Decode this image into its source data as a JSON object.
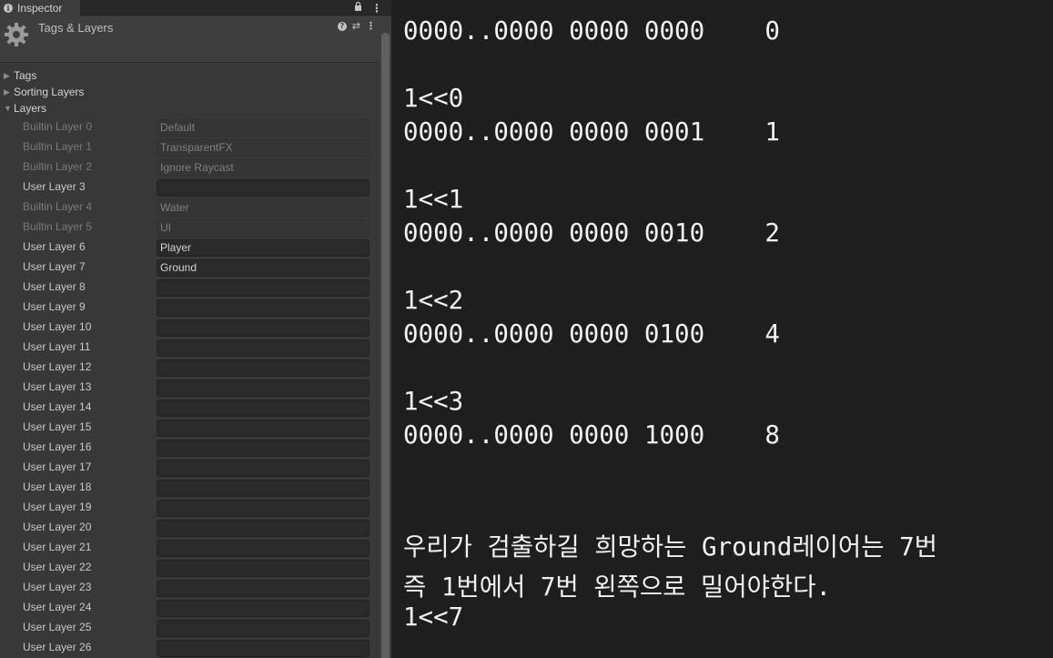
{
  "inspector": {
    "tab_label": "Inspector",
    "title": "Tags & Layers",
    "foldouts": [
      {
        "label": "Tags",
        "expanded": false
      },
      {
        "label": "Sorting Layers",
        "expanded": false
      },
      {
        "label": "Layers",
        "expanded": true
      }
    ],
    "layers": [
      {
        "label": "Builtin Layer 0",
        "value": "Default",
        "builtin": true
      },
      {
        "label": "Builtin Layer 1",
        "value": "TransparentFX",
        "builtin": true
      },
      {
        "label": "Builtin Layer 2",
        "value": "Ignore Raycast",
        "builtin": true
      },
      {
        "label": "User Layer 3",
        "value": "",
        "builtin": false
      },
      {
        "label": "Builtin Layer 4",
        "value": "Water",
        "builtin": true
      },
      {
        "label": "Builtin Layer 5",
        "value": "UI",
        "builtin": true
      },
      {
        "label": "User Layer 6",
        "value": "Player",
        "builtin": false
      },
      {
        "label": "User Layer 7",
        "value": "Ground",
        "builtin": false
      },
      {
        "label": "User Layer 8",
        "value": "",
        "builtin": false
      },
      {
        "label": "User Layer 9",
        "value": "",
        "builtin": false
      },
      {
        "label": "User Layer 10",
        "value": "",
        "builtin": false
      },
      {
        "label": "User Layer 11",
        "value": "",
        "builtin": false
      },
      {
        "label": "User Layer 12",
        "value": "",
        "builtin": false
      },
      {
        "label": "User Layer 13",
        "value": "",
        "builtin": false
      },
      {
        "label": "User Layer 14",
        "value": "",
        "builtin": false
      },
      {
        "label": "User Layer 15",
        "value": "",
        "builtin": false
      },
      {
        "label": "User Layer 16",
        "value": "",
        "builtin": false
      },
      {
        "label": "User Layer 17",
        "value": "",
        "builtin": false
      },
      {
        "label": "User Layer 18",
        "value": "",
        "builtin": false
      },
      {
        "label": "User Layer 19",
        "value": "",
        "builtin": false
      },
      {
        "label": "User Layer 20",
        "value": "",
        "builtin": false
      },
      {
        "label": "User Layer 21",
        "value": "",
        "builtin": false
      },
      {
        "label": "User Layer 22",
        "value": "",
        "builtin": false
      },
      {
        "label": "User Layer 23",
        "value": "",
        "builtin": false
      },
      {
        "label": "User Layer 24",
        "value": "",
        "builtin": false
      },
      {
        "label": "User Layer 25",
        "value": "",
        "builtin": false
      },
      {
        "label": "User Layer 26",
        "value": "",
        "builtin": false
      }
    ]
  },
  "notes": {
    "lines": [
      "0000..0000 0000 0000    0",
      "",
      "1<<0",
      "0000..0000 0000 0001    1",
      "",
      "1<<1",
      "0000..0000 0000 0010    2",
      "",
      "1<<2",
      "0000..0000 0000 0100    4",
      "",
      "1<<3",
      "0000..0000 0000 1000    8"
    ],
    "korean_line_1": "우리가 검출하길 희망하는 Ground레이어는 7번",
    "korean_line_2": "즉 1번에서 7번 왼쪽으로 밀어야한다.",
    "final_line": "1<<7"
  }
}
